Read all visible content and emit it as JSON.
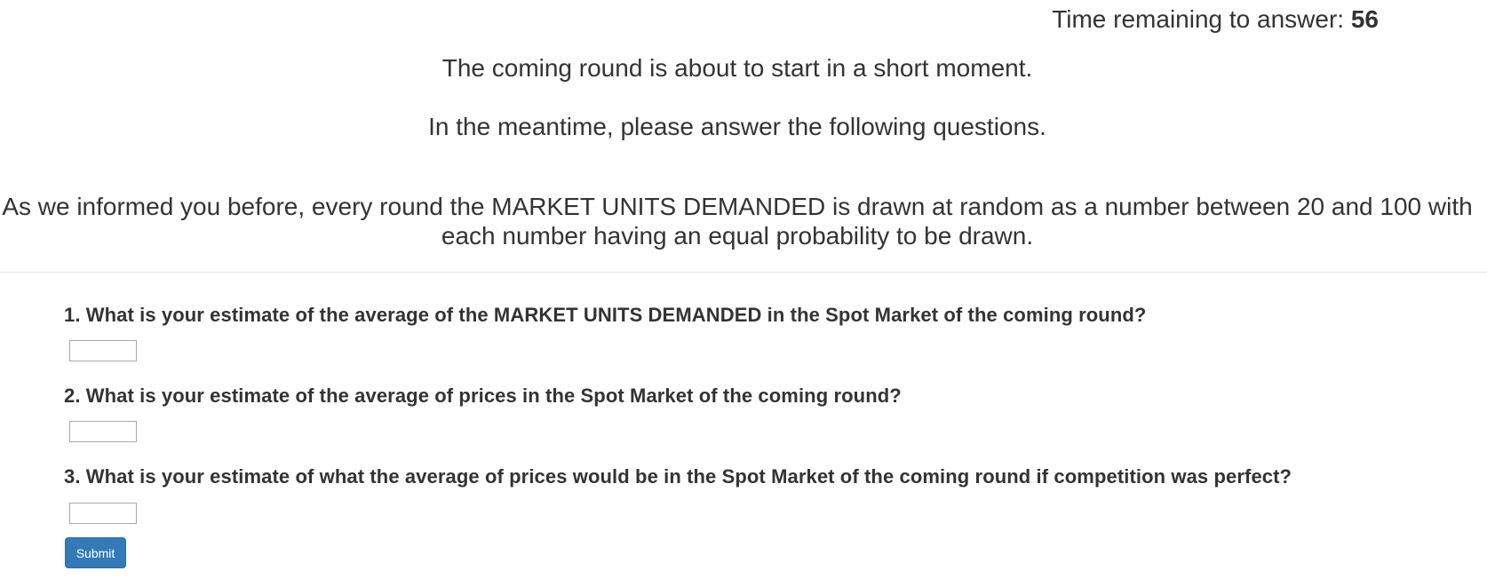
{
  "timer": {
    "label": "Time remaining to answer: ",
    "value": "56"
  },
  "intro": {
    "line1": "The coming round is about to start in a short moment.",
    "line2": "In the meantime, please answer the following questions.",
    "line3": "As we informed you before, every round the MARKET UNITS DEMANDED is drawn at random as a number between 20 and 100 with each number having an equal probability to be drawn."
  },
  "questions": [
    {
      "text": "1. What is your estimate of the average of the MARKET UNITS DEMANDED in the Spot Market of the coming round?",
      "answer_value": ""
    },
    {
      "text": "2. What is your estimate of the average of prices in the Spot Market of the coming round?",
      "answer_value": ""
    },
    {
      "text": "3. What is your estimate of what the average of prices would be in the Spot Market of the coming round if competition was perfect?",
      "answer_value": ""
    }
  ],
  "submit": {
    "label": "Submit"
  },
  "colors": {
    "text": "#333333",
    "button": "#337ab7",
    "button_text": "#ffffff",
    "divider": "#e5e5e5"
  }
}
